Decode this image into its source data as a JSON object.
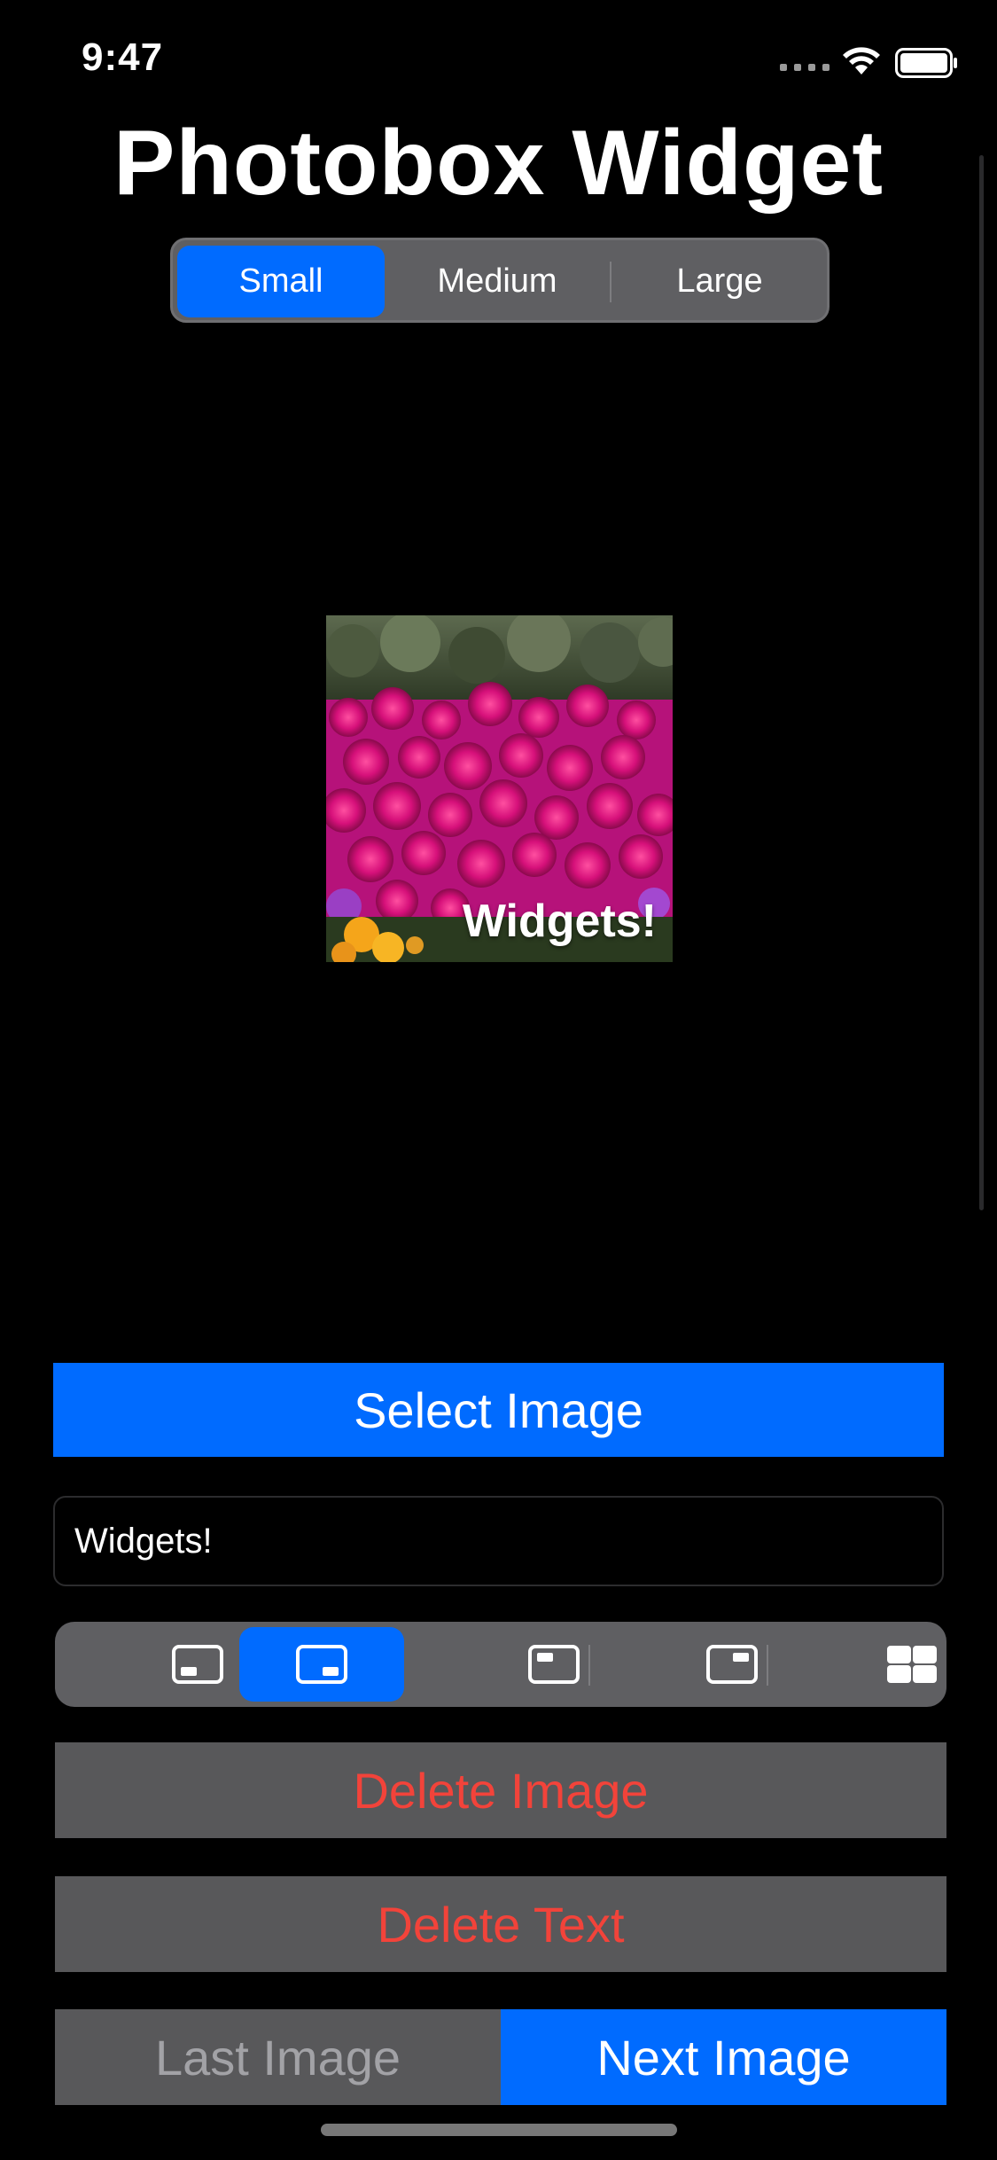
{
  "status_bar": {
    "time": "9:47"
  },
  "title": "Photobox Widget",
  "size_selector": {
    "options": [
      "Small",
      "Medium",
      "Large"
    ],
    "selected": "Small"
  },
  "preview": {
    "caption": "Widgets!"
  },
  "buttons": {
    "select_image": "Select Image",
    "delete_image": "Delete Image",
    "delete_text": "Delete Text",
    "last_image": "Last Image",
    "next_image": "Next Image"
  },
  "caption_field": {
    "value": "Widgets!"
  },
  "position_selector": {
    "options": [
      {
        "icon": "bottom-left-position-icon"
      },
      {
        "icon": "bottom-right-position-icon"
      },
      {
        "icon": "top-left-position-icon"
      },
      {
        "icon": "top-right-position-icon"
      },
      {
        "icon": "grid-position-icon"
      }
    ],
    "selected_index": 1
  },
  "colors": {
    "accent": "#006bff",
    "destructive": "#f2433a",
    "button_gray": "#58585a",
    "segment_background": "#5f5f62"
  }
}
